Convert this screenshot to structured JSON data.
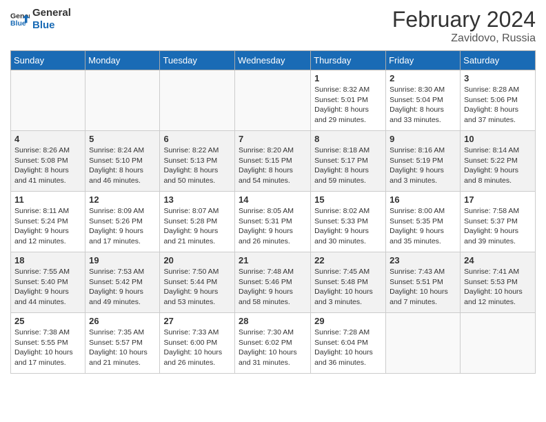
{
  "header": {
    "logo_line1": "General",
    "logo_line2": "Blue",
    "month": "February 2024",
    "location": "Zavidovo, Russia"
  },
  "weekdays": [
    "Sunday",
    "Monday",
    "Tuesday",
    "Wednesday",
    "Thursday",
    "Friday",
    "Saturday"
  ],
  "weeks": [
    [
      {
        "day": "",
        "info": ""
      },
      {
        "day": "",
        "info": ""
      },
      {
        "day": "",
        "info": ""
      },
      {
        "day": "",
        "info": ""
      },
      {
        "day": "1",
        "info": "Sunrise: 8:32 AM\nSunset: 5:01 PM\nDaylight: 8 hours and 29 minutes."
      },
      {
        "day": "2",
        "info": "Sunrise: 8:30 AM\nSunset: 5:04 PM\nDaylight: 8 hours and 33 minutes."
      },
      {
        "day": "3",
        "info": "Sunrise: 8:28 AM\nSunset: 5:06 PM\nDaylight: 8 hours and 37 minutes."
      }
    ],
    [
      {
        "day": "4",
        "info": "Sunrise: 8:26 AM\nSunset: 5:08 PM\nDaylight: 8 hours and 41 minutes."
      },
      {
        "day": "5",
        "info": "Sunrise: 8:24 AM\nSunset: 5:10 PM\nDaylight: 8 hours and 46 minutes."
      },
      {
        "day": "6",
        "info": "Sunrise: 8:22 AM\nSunset: 5:13 PM\nDaylight: 8 hours and 50 minutes."
      },
      {
        "day": "7",
        "info": "Sunrise: 8:20 AM\nSunset: 5:15 PM\nDaylight: 8 hours and 54 minutes."
      },
      {
        "day": "8",
        "info": "Sunrise: 8:18 AM\nSunset: 5:17 PM\nDaylight: 8 hours and 59 minutes."
      },
      {
        "day": "9",
        "info": "Sunrise: 8:16 AM\nSunset: 5:19 PM\nDaylight: 9 hours and 3 minutes."
      },
      {
        "day": "10",
        "info": "Sunrise: 8:14 AM\nSunset: 5:22 PM\nDaylight: 9 hours and 8 minutes."
      }
    ],
    [
      {
        "day": "11",
        "info": "Sunrise: 8:11 AM\nSunset: 5:24 PM\nDaylight: 9 hours and 12 minutes."
      },
      {
        "day": "12",
        "info": "Sunrise: 8:09 AM\nSunset: 5:26 PM\nDaylight: 9 hours and 17 minutes."
      },
      {
        "day": "13",
        "info": "Sunrise: 8:07 AM\nSunset: 5:28 PM\nDaylight: 9 hours and 21 minutes."
      },
      {
        "day": "14",
        "info": "Sunrise: 8:05 AM\nSunset: 5:31 PM\nDaylight: 9 hours and 26 minutes."
      },
      {
        "day": "15",
        "info": "Sunrise: 8:02 AM\nSunset: 5:33 PM\nDaylight: 9 hours and 30 minutes."
      },
      {
        "day": "16",
        "info": "Sunrise: 8:00 AM\nSunset: 5:35 PM\nDaylight: 9 hours and 35 minutes."
      },
      {
        "day": "17",
        "info": "Sunrise: 7:58 AM\nSunset: 5:37 PM\nDaylight: 9 hours and 39 minutes."
      }
    ],
    [
      {
        "day": "18",
        "info": "Sunrise: 7:55 AM\nSunset: 5:40 PM\nDaylight: 9 hours and 44 minutes."
      },
      {
        "day": "19",
        "info": "Sunrise: 7:53 AM\nSunset: 5:42 PM\nDaylight: 9 hours and 49 minutes."
      },
      {
        "day": "20",
        "info": "Sunrise: 7:50 AM\nSunset: 5:44 PM\nDaylight: 9 hours and 53 minutes."
      },
      {
        "day": "21",
        "info": "Sunrise: 7:48 AM\nSunset: 5:46 PM\nDaylight: 9 hours and 58 minutes."
      },
      {
        "day": "22",
        "info": "Sunrise: 7:45 AM\nSunset: 5:48 PM\nDaylight: 10 hours and 3 minutes."
      },
      {
        "day": "23",
        "info": "Sunrise: 7:43 AM\nSunset: 5:51 PM\nDaylight: 10 hours and 7 minutes."
      },
      {
        "day": "24",
        "info": "Sunrise: 7:41 AM\nSunset: 5:53 PM\nDaylight: 10 hours and 12 minutes."
      }
    ],
    [
      {
        "day": "25",
        "info": "Sunrise: 7:38 AM\nSunset: 5:55 PM\nDaylight: 10 hours and 17 minutes."
      },
      {
        "day": "26",
        "info": "Sunrise: 7:35 AM\nSunset: 5:57 PM\nDaylight: 10 hours and 21 minutes."
      },
      {
        "day": "27",
        "info": "Sunrise: 7:33 AM\nSunset: 6:00 PM\nDaylight: 10 hours and 26 minutes."
      },
      {
        "day": "28",
        "info": "Sunrise: 7:30 AM\nSunset: 6:02 PM\nDaylight: 10 hours and 31 minutes."
      },
      {
        "day": "29",
        "info": "Sunrise: 7:28 AM\nSunset: 6:04 PM\nDaylight: 10 hours and 36 minutes."
      },
      {
        "day": "",
        "info": ""
      },
      {
        "day": "",
        "info": ""
      }
    ]
  ]
}
